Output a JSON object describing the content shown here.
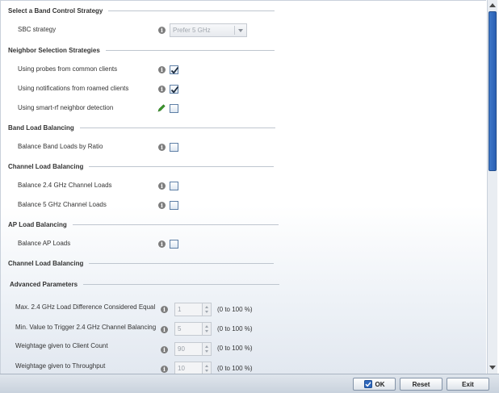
{
  "sections": {
    "band_control": "Select a Band Control Strategy",
    "neighbor": "Neighbor Selection Strategies",
    "band_load": "Band Load Balancing",
    "channel_load": "Channel Load Balancing",
    "ap_load": "AP Load Balancing",
    "channel_load_2": "Channel Load Balancing",
    "advanced": "Advanced Parameters"
  },
  "fields": {
    "sbc_strategy": {
      "label": "SBC strategy",
      "value": "Prefer 5 GHz"
    },
    "probes_common": {
      "label": "Using probes from common clients",
      "checked": true
    },
    "notifications_roamed": {
      "label": "Using notifications from roamed clients",
      "checked": true
    },
    "smart_rf": {
      "label": "Using smart-rf neighbor detection",
      "checked": false
    },
    "band_ratio": {
      "label": "Balance Band Loads by Ratio",
      "checked": false
    },
    "balance_24": {
      "label": "Balance 2.4 GHz Channel Loads",
      "checked": false
    },
    "balance_5": {
      "label": "Balance 5 GHz Channel Loads",
      "checked": false
    },
    "balance_ap": {
      "label": "Balance AP Loads",
      "checked": false
    }
  },
  "advanced": [
    {
      "label": "Max. 2.4 GHz Load Difference Considered Equal",
      "value": "1",
      "range": "(0 to 100 %)"
    },
    {
      "label": "Min. Value to Trigger 2.4 GHz Channel Balancing",
      "value": "5",
      "range": "(0 to 100 %)"
    },
    {
      "label": "Weightage given to Client Count",
      "value": "90",
      "range": "(0 to 100 %)"
    },
    {
      "label": "Weightage given to Throughput",
      "value": "10",
      "range": "(0 to 100 %)"
    }
  ],
  "footer": {
    "ok": "OK",
    "reset": "Reset",
    "exit": "Exit"
  },
  "icons": {
    "info": "info-icon",
    "edit": "pencil-icon",
    "ok": "check-icon"
  },
  "colors": {
    "scroll_thumb": "#2f68bd",
    "checkbox_border": "#5e7fa6",
    "pencil": "#3a9a2a"
  }
}
